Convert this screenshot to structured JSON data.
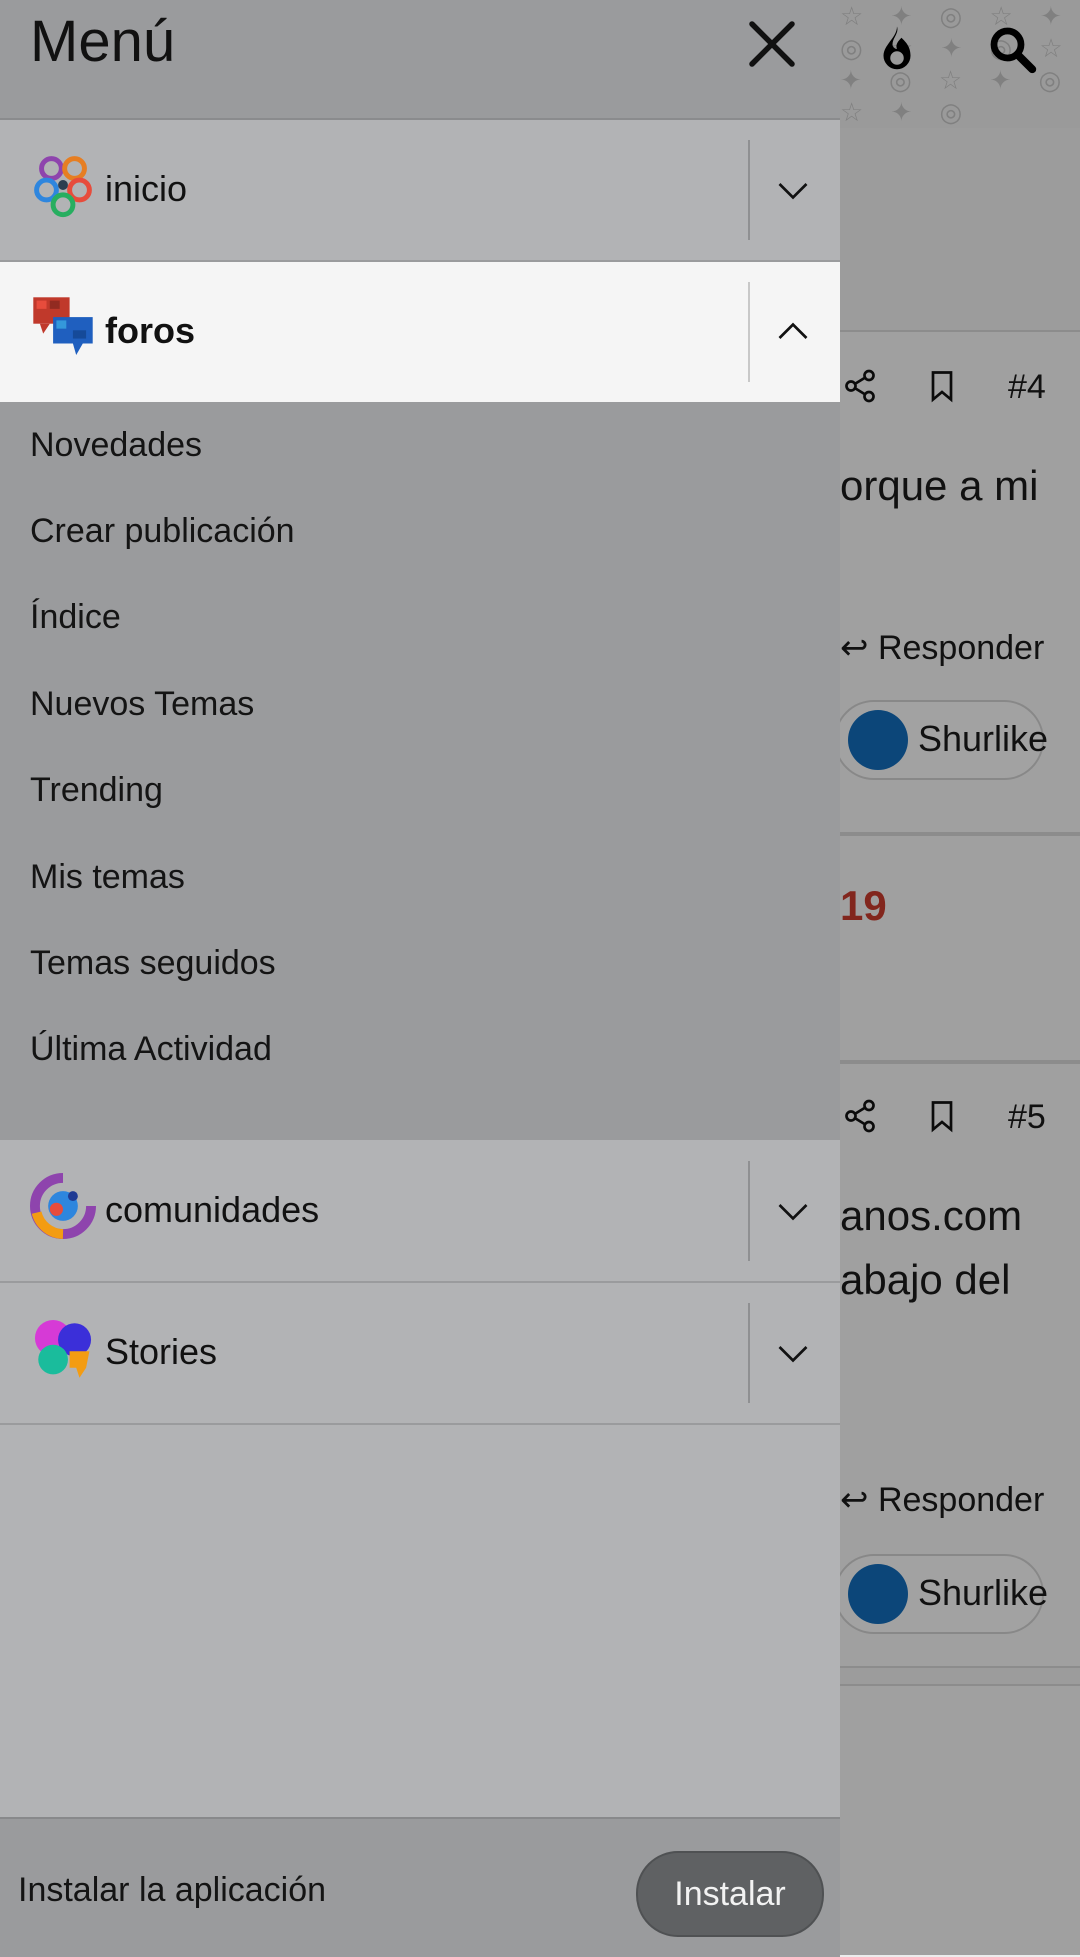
{
  "drawer": {
    "title": "Menú",
    "sections": [
      {
        "label": "inicio",
        "expanded": false,
        "icon": "inicio-logo-icon"
      },
      {
        "label": "foros",
        "expanded": true,
        "icon": "foros-logo-icon",
        "items": [
          "Novedades",
          "Crear publicación",
          "Índice",
          "Nuevos Temas",
          "Trending",
          "Mis temas",
          "Temas seguidos",
          "Última Actividad"
        ]
      },
      {
        "label": "comunidades",
        "expanded": false,
        "icon": "comunidades-logo-icon"
      },
      {
        "label": "Stories",
        "expanded": false,
        "icon": "stories-logo-icon"
      }
    ],
    "install": {
      "text": "Instalar la aplicación",
      "button_label": "Instalar"
    }
  },
  "background": {
    "header_icons": [
      "fire-icon",
      "search-icon"
    ],
    "posts": [
      {
        "number": "#4",
        "text": "orque a mi",
        "reply_label": "Responder",
        "like_label": "Shurlike"
      },
      {
        "year_fragment": "19"
      },
      {
        "number": "#5",
        "text_lines": [
          "anos.com",
          "abajo del"
        ],
        "reply_label": "Responder",
        "like_label": "Shurlike"
      }
    ]
  },
  "colors": {
    "drawer": "#b2b3b5",
    "drawer_header": "#9a9b9d",
    "expanded_section": "#f5f5f5",
    "accent_like": "#1268b3",
    "year_red": "#c0392b"
  }
}
